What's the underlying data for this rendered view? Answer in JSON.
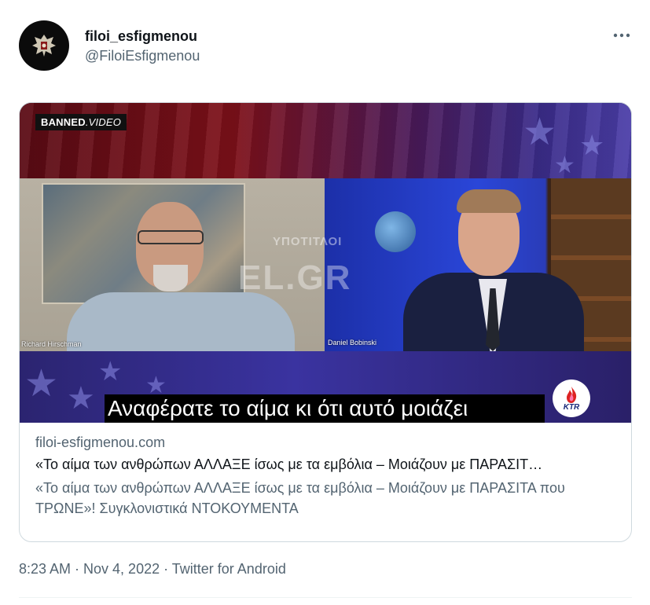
{
  "tweet": {
    "display_name": "filoi_esfigmenou",
    "handle": "@FiloiEsfigmenou",
    "more_icon": "ellipsis-icon",
    "timestamp": "8:23 AM · Nov 4, 2022 · Twitter for Android"
  },
  "card": {
    "media": {
      "badge_bold": "BANNED",
      "badge_rest": ".VIDEO",
      "watermark_main": "EL.GR",
      "watermark_sub": "ΥΠΟΤΙΤΛΟΙ",
      "name_left": "Richard Hirschman",
      "name_right": "Daniel Bobinski",
      "subtitle": "Αναφέρατε το αίμα κι ότι αυτό μοιάζει",
      "logo_text": "KTR"
    },
    "domain": "filoi-esfigmenou.com",
    "title": "«Το αίμα των ανθρώπων ΑΛΛΑΞΕ ίσως με τα εμβόλια – Μοιάζουν με ΠΑΡΑΣΙΤ…",
    "description": "«Το αίμα των ανθρώπων ΑΛΛΑΞΕ ίσως με τα εμβόλια – Μοιάζουν με ΠΑΡΑΣΙΤΑ που ΤΡΩΝΕ»! Συγκλονιστικά ΝΤΟΚΟΥΜΕΝΤΑ"
  },
  "colors": {
    "text_primary": "#0f1419",
    "text_secondary": "#536471",
    "border": "#cfd9de"
  }
}
